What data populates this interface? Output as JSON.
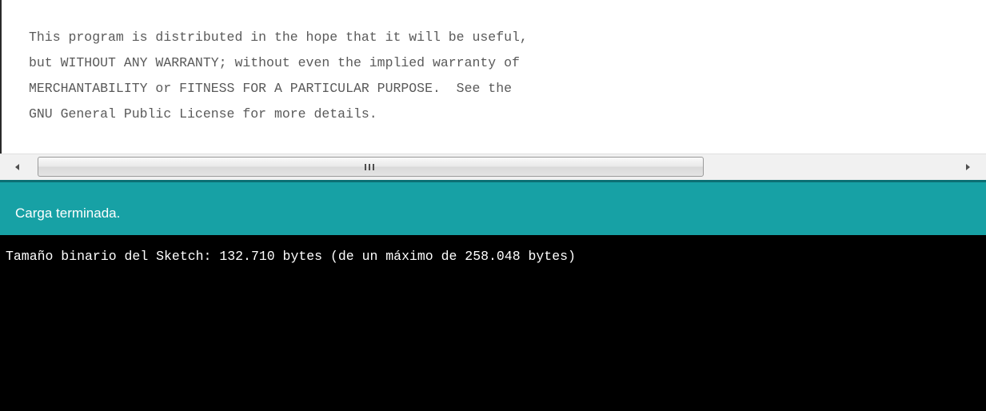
{
  "editor": {
    "lines": [
      "This program is distributed in the hope that it will be useful,",
      "but WITHOUT ANY WARRANTY; without even the implied warranty of",
      "MERCHANTABILITY or FITNESS FOR A PARTICULAR PURPOSE.  See the",
      "GNU General Public License for more details."
    ]
  },
  "scrollbar": {
    "left_arrow_icon": "chevron-left-icon",
    "right_arrow_icon": "chevron-right-icon",
    "grip_icon": "scroll-grip-icon"
  },
  "status": {
    "text": "Carga terminada."
  },
  "console": {
    "lines": [
      "Tamaño binario del Sketch: 132.710 bytes (de un máximo de 258.048 bytes)"
    ]
  },
  "colors": {
    "status_bar": "#17a1a5",
    "console_bg": "#000000",
    "console_text": "#ffffff",
    "code_text": "#5a5a5a"
  }
}
